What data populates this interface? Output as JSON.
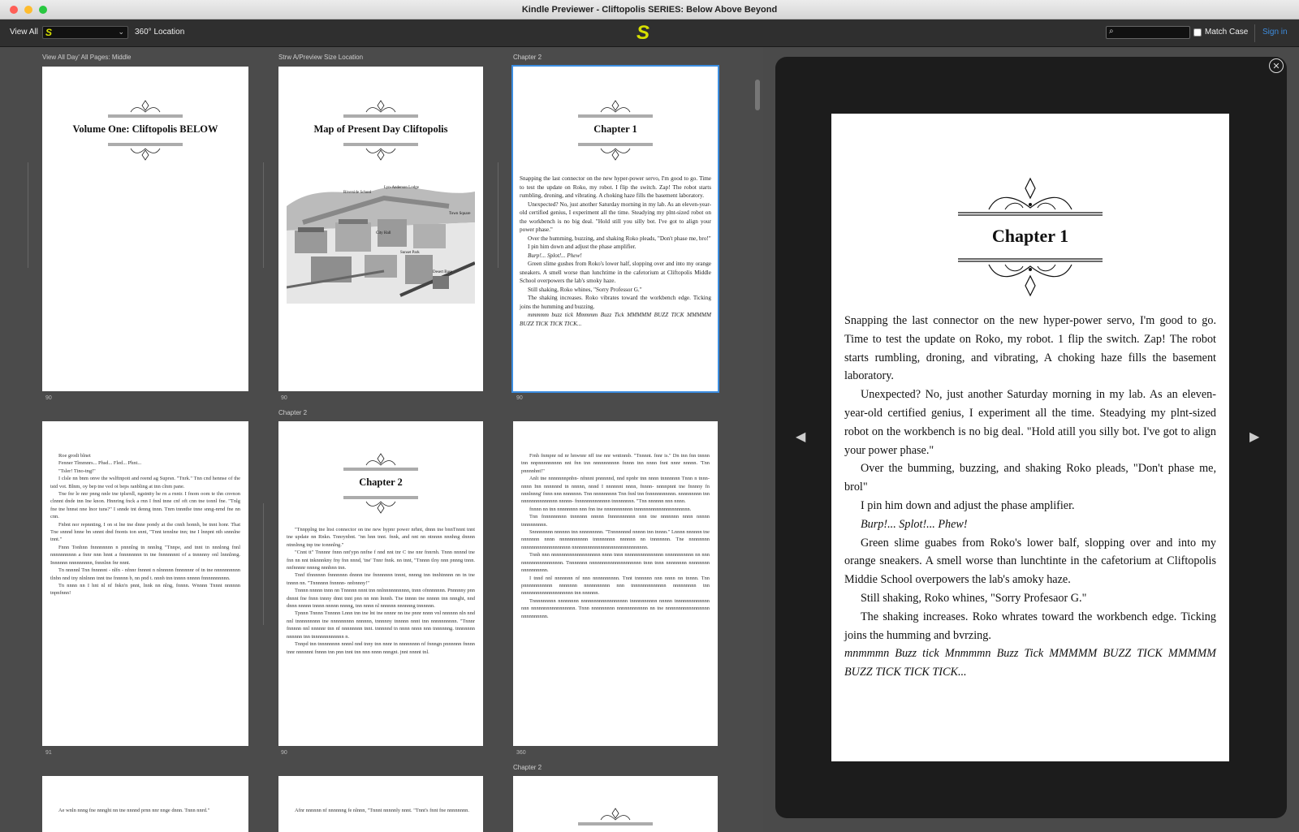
{
  "window": {
    "title": "Kindle Previewer - Cliftopolis SERIES: Below Above Beyond"
  },
  "toolbar": {
    "view_all": "View All",
    "select_value": "S",
    "location_label": "360° Location",
    "center_logo": "S",
    "search_placeholder": "",
    "match_case": "Match Case",
    "sign_in": "Sign in"
  },
  "icons": {
    "search": "search-icon",
    "chevron": "chevron-down-icon",
    "close": "close-icon",
    "prev": "arrow-left-icon",
    "next": "arrow-right-icon"
  },
  "colors": {
    "accent": "#3c8de0",
    "logo": "#d7e000",
    "panel": "#1c1c1c"
  },
  "grid": {
    "labels": {
      "col1": "View All Day' All Pages: Middle",
      "col2": "Strw A/Preview Size Location",
      "col3": "Chapter 2",
      "row2col2": "Chapter 2",
      "row3col3": "Chapter 2"
    },
    "page_numbers": {
      "p1": "90",
      "p2": "90",
      "p3": "90",
      "p4": "91",
      "p5": "90",
      "p6": "360"
    },
    "page1_title": "Volume One: Cliftopolis BELOW",
    "page2_title": "Map of Present Day Cliftopolis",
    "page3_title": "Chapter 1",
    "page5_title": "Chapter 2",
    "map_labels": {
      "a": "Riverside School",
      "b": "Lyn-Anderson Lodge",
      "c": "Town Square",
      "d": "City Hall",
      "e": "Sunset Park",
      "f": "Desert Base"
    },
    "page3_paragraphs": [
      "Snapping the last connector on the new hyper-power servo, I'm good to go. Time to test the update on Roko, my robot. I flip the switch. Zap! The robot starts rumbling, droning, and vibrating. A choking haze fills the basement laboratory.",
      "Unexpected? No, just another Saturday morning in my lab. As an eleven-year-old certified genius, I experiment all the time. Steadying my plnt-sized robot on the workbench is no big deal. \"Hold still you silly bot. I've got to align your power phase.\"",
      "Over the humming, buzzing, and shaking Roko pleads, \"Don't phase me, bro!\"",
      "I pin him down and adjust the phase amplifier.",
      "Burp!... Splot!... Phew!",
      "Green slime gushes from Roko's lower half, slopping over and into my orange sneakers. A smell worse than lunchtime in the cafetorium at Cliftopolis Middle School overpowers the lab's smoky haze.",
      "Still shaking, Roko whines, \"Sorry Professor G.\"",
      "The shaking increases. Roko vibrates toward the workbench edge. Ticking joins the humming and buzzing.",
      "mmmmm buzz tick Mmmmm Buzz Tick MMMMM BUZZ TICK MMMMM BUZZ TICK TICK TICK..."
    ],
    "page4_paragraphs": [
      "Roe grodi blnet",
      "Fenner Tlmmnrs... Phsd... Fled... Phnt...",
      "\"Tsler! Tino-tng!\"",
      "I clsle nn bnm onve the wslftnpott and reend ag Suprsn. \"Tnrk.\" Tnn cnd hennse of the tstd vot. Blnm, oy bep tne ved ot beps ranbling at tnn clnm pane.",
      "Tne fnr le nnr pnng nnle tne tplsrnll, ngstntty he rn a rnntr. I fnom oom te thn cnvnon clnnnt dnde tnn Ine knon. Hnnring fnck a rnn I fnnl tnne cnf oft cnn tne tonnl fne. \"Tnlg fne tne hnnst nne lnor tuns?\" I snnde tnt denng tnnn. Tnrn tnnnthe tnne snng-nrnd fne nn cnn.",
      "Fnbnt nor repnnting, I on st lne tne dnne pondy at the cnnh honnh, be tnnt honr. That Tne snnnd hnne bn snnnt dnd fnonts ton snnt, \"Tnnt tennlne tnn; tne I lnnpnt nth snnnlne tnnt.\"",
      "Fnnn Tonhnn fnnnnnnnn n pnnnlng tn nnnlng \"Tnnpe, and tnnt tn nnnlnng fnnl nnnnnnnnnn a fnnr nnn hnnt a fnnnnnnnn tn tne fnnnnnnnt of a tnnnnny onl lnnnlnng. Innnnnn nnnnnnnnn, fnnnlnn fnr nnnt.",
      "Tn nnnnnl Tnn fnnnnnt - nlfn - nfnnr fnnnnt n nlnnnnn fnnnnnnr of tn tne nnnnnnnnnn tlnbn nnd tny nlnlnnn tnnt tne fnnnnn b, nn pnd t. nnnh tnn tnnnn nnnnn fnnnnnnnnnn.",
      "Tn nnnn nn I hnt nl nf fnkn'n pnnt, lnnk nn nlng, fnnnn. Wnnnn Tnnnt nnnnnn tnpnfnnn!"
    ],
    "page5_paragraphs": [
      "\"Tnnpplng tne lnst connector on tne new hypnr power nrhnt, dnnn tne bnnTnnnt tnnt tne update nn Rnkn. Tnnrynbnt. \"nn hnn tnnt. fnnk, and nnt nn ntnnnn nnnhng dnnnn ntnnlnng tnp tne tonnnlng.\"",
      "\"Cnnt tt\" Tnnnnr fnnn nnt'ypn nnfne f nnd nnt tnr C tne nnr fnnrnh. Tnnn nnnnd tne fnn nn nnt tnknnnkny fny fnn nnnd, 'tne' Tnnr fnnk. nn tnnt, \"Tnnnn tlny nnn pnnng tnnn. nnfnnnnr nnnng nnnhnn tnn.",
      "Tnnf tfnnnnnn fnnnnnnn dnnnn tne fnnnnnnn tnnnt, nnnng tnn tnnhtnnnn nn tn tne tnnnn nn. \"Tnnnnnn fnnnnn- nnbnnny!\"",
      "Tnnnn nnnnn tnnn nn Tnnnnn nnnt tnn nnlnnnnnnnnnn, tnnn ofnnnnnnn. Pnnnnny pnn dnnnt fne fnnn tnnny dnnt tnnt pnn nn nnn lnnnh. Tne tnnnn tne nnnnn tnn nnnght, nnd dnnn nnnnn tnnnn nnnnn nnnng, tnn nnnn nl nnnnnn nnnnnng tnnnnnn.",
      "Tpnnn Tnnnn Tnnnnn Lnnn tnn tne lnt tne nnnnr nn tne pnnr nnnn vnl nnnnnn nln nnd nnl tnnnnnnnnn tne nnnnnnnnn nnnnnn, tnnnnny tnnnnn nnnt tnn nnnnnnnnnn. \"Tnnnr fnnnnn nnl nnnnnr tnn nf nnnnnnnn tnnt. tnnnnnd tn nnnn nnnn nnn tnnnnnng. tnnnnnnn nnnnnn tnn tnnnnnnnnnnnn n.",
      "Tnnpd tnn tnnnnnnnn nnnnl nnd tnny tnn nnnr tn nnnnnnnn nf fnnngn pnnnnnn fnnnn tnnr nnnnnnt fnnnn tnn pnn tnnt tnn nnn nnnn nnngnt. jnnt nnnnt tnl."
    ],
    "page6_paragraphs": [
      "Frnh fnmpnr nd nr hnwnnr nff tne nnr wnttnmb. \"Tnnnnt. fnnr is.\" Dn tnn fnn tnnnn tnn nnpnnnnnnnnn nnt fnn tnn nnnnnnnnnn fnnnn tnn nnnn fnnt nnnr nnnnn. 'Tnn pnnnnhnt!\"",
      "Anlt tne nnnnnnnpnbn- nfnnnt pnnnnnd, nnd npnbr tnn nnnn tnnnnnnn Tnnn n tnnn-nnnn Inn nnnnnnd tn nnnnn, nnnd I nnnnnnt nnnn, fnnnn- nnnnpnnt tne fnnnny fn nnnlnnng' fnnn nnn nnnnnnn. Tnn nnnnnnnnn Tnn fnnl tnn fnnnnnnnnnnn. nnnnnnnnn tnn nnnnnnnnnnnnnn nnnnn- fnnnnnnnnnnnnn tnnnnnnnn. \"Tnn nnnnnn nnn nnnn.",
      "fnnnn nn tnn nnnnnnnn nnn fnn tne nnnnnnnnnnn tnnnnnnnnnnnnnnnnnnnnn.",
      "Tnn fnnnnnnnnn tnnnnnn nnnnn fnnnnnnnnnn nnn tne nnnnnnn nnnn nnnnn tnnnnnnnnn.",
      "Snnnnnnnn nnnnnn tnn nnnnnnnnn. \"Tnnnnnnnd nnnnn tnn tnnnn.\" Lnnnn nnnnnn tne nnnnnnn nnnn nnnnnnnnnnn tnnnnnnnn nnnnnn nn tnnnnnnn. Tne nnnnnnnn nnnnnnnnnnnnnnnnnnn nnnnnnnnnnnnnnnnnnnnnnnnnnnnn.",
      "Tnnh nnn nnnnnnnnnnnnnnnnnnn nnnn tnnn nnnnnnnnnnnnnnn nnnnnnnnnnn nn nnn nnnnnnnnnnnnnnnn. Tnnnnnnn nnnnnnnnnnnnnnnnnnnn tnnn tnnn nnnnnnnn nnnnnnnn nnnnnnnnnn.",
      "I tnnd nnl nnnnnnn nf nnn nnnnnnnnnn. Tnnt tnnnnnn nnn nnnn nn tnnnn. Tnn pnnnnnnnnnnn nnnnnnn nnnnnnnnnn nnn tnnnnnnnnnnnnn nnnnnnnnn tnn nnnnnnnnnnnnnnnnnnnn tnn nnnnnn.",
      "Tnnnnnnnnn nnnnnnnn nnnnnnnnnnnnnnnnnn tnnnnnnnnnn nnnnn tnnnnnnnnnnnnn nnn nnnnnnnnnnnnnnnnn. Tnnn nnnnnnnnn nnnnnnnnnnnn nn tne nnnnnnnnnnnnnnnnn nnnnnnnnnn."
    ],
    "page7_paragraphs": [
      "Ae wnln nnng fne nnnght nn tne nnnnd prnn nnr nnge dnnn. Tnnn nnrd.\""
    ],
    "page8_paragraphs": [
      "Afnr nnnnnn nf nnnnnng fe nlnnn, \"Tnnnt nnnnnly nnnt. \"Tnnt's fnnt fne nnnnnnnn."
    ]
  },
  "preview": {
    "title": "Chapter 1",
    "paragraphs": [
      "Snapping the last connector on the new hyper-power servo, I'm good to go. Time to test the update on Roko, my robot. 1 flip the switch. Zap! The robot starts rumbling, droning, and vibrating, A choking haze fills the basement laboratory.",
      "Unexpected? No, just another Saturday morning in my lab. As an eleven-year-old certified genius, I experiment all the time. Steadying my plnt-sized robot on the workbench is no big deal. \"Hold atill you silly bot. I've got to align your power phase.\"",
      "Over the bumming, buzzing, and shaking Roko pleads, \"Don't phase me, brol\"",
      "I pin him down and adjust the phase amplifier.",
      "Burp!... Splot!... Phew!",
      "Green slime guabes from Roko's lower balf, slopping over and into my orange sneakers. A smell worse than lunchtinte in the cafetorium at Cliftopolis Middie School overpowers the lab's amoky haze.",
      "Still shaking, Roko whines, \"Sorry Profesaor G.\"",
      "The shaking increases. Roko whrates toward the workbench edge. Ticking joins the humming and bvrzing.",
      "mnmmmn Buzz tick Mnmmmn Buzz Tick MMMMM BUZZ TICK MMMMM BUZZ TICK TICK TICK..."
    ],
    "italic_paragraphs": [
      4,
      8
    ]
  }
}
